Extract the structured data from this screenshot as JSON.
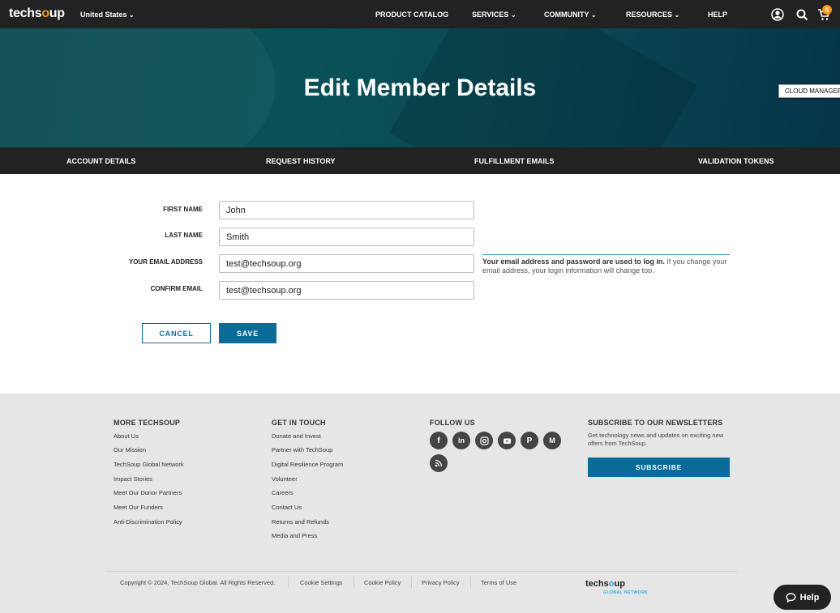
{
  "header": {
    "logo_left": "techs",
    "logo_o": "o",
    "logo_right": "up",
    "region": "United States",
    "nav": [
      {
        "label": "PRODUCT CATALOG"
      },
      {
        "label": "SERVICES"
      },
      {
        "label": "COMMUNITY"
      },
      {
        "label": "RESOURCES"
      },
      {
        "label": "HELP"
      }
    ],
    "cart_count": "0"
  },
  "hero": {
    "title": "Edit Member Details",
    "cloud_manager": "CLOUD MANAGER"
  },
  "subnav": {
    "items": [
      "ACCOUNT DETAILS",
      "REQUEST HISTORY",
      "FULFILLMENT EMAILS",
      "VALIDATION TOKENS"
    ]
  },
  "form": {
    "first_name_label": "FIRST NAME",
    "first_name_value": "John",
    "last_name_label": "LAST NAME",
    "last_name_value": "Smith",
    "email_label": "YOUR EMAIL ADDRESS",
    "email_value": "test@techsoup.org",
    "confirm_label": "CONFIRM EMAIL",
    "confirm_value": "test@techsoup.org",
    "help_bold": "Your email address and password are used to log in.",
    "help_rest": " If you change your email address, your login information will change too.",
    "cancel_label": "CANCEL",
    "save_label": "SAVE"
  },
  "footer": {
    "more": {
      "heading": "MORE TECHSOUP",
      "links": [
        "About Us",
        "Our Mission",
        "TechSoup Global Network",
        "Impact Stories",
        "Meet Our Donor Partners",
        "Meet Our Funders",
        "Anti-Discrimination Policy"
      ]
    },
    "touch": {
      "heading": "GET IN TOUCH",
      "links": [
        "Donate and Invest",
        "Partner with TechSoup",
        "Digital Resilience Program",
        "Volunteer",
        "Careers",
        "Contact Us",
        "Returns and Refunds",
        "Media and Press"
      ]
    },
    "follow": {
      "heading": "FOLLOW US",
      "icons": [
        "facebook-icon",
        "linkedin-icon",
        "instagram-icon",
        "youtube-icon",
        "pinterest-icon",
        "medium-icon",
        "rss-icon"
      ]
    },
    "newsletter": {
      "heading": "SUBSCRIBE TO OUR NEWSLETTERS",
      "text": "Get technology news and updates on exciting new offers from TechSoup.",
      "button": "SUBSCRIBE"
    },
    "copyright": "Copyright © 2024, TechSoup Global. All Rights Reserved.",
    "bottom_links": [
      "Cookie Settings",
      "Cookie Policy",
      "Privacy Policy",
      "Terms of Use"
    ],
    "logo_left": "techs",
    "logo_o": "o",
    "logo_right": "up",
    "logo_sub": "GLOBAL NETWORK"
  },
  "help_button": "Help",
  "colors": {
    "accent": "#0a6b99",
    "brand_orange": "#f7941d",
    "dark_bar": "#222222",
    "footer_bg": "#e6e6e6"
  }
}
